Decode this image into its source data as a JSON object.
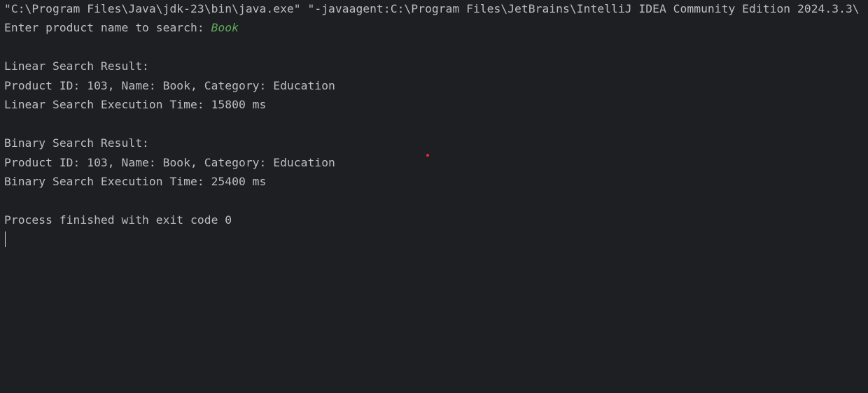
{
  "console": {
    "command_line": "\"C:\\Program Files\\Java\\jdk-23\\bin\\java.exe\" \"-javaagent:C:\\Program Files\\JetBrains\\IntelliJ IDEA Community Edition 2024.3.3\\",
    "prompt": "Enter product name to search: ",
    "user_input": "Book",
    "linear_header": "Linear Search Result:",
    "linear_result": "Product ID: 103, Name: Book, Category: Education",
    "linear_time": "Linear Search Execution Time: 15800 ms",
    "binary_header": "Binary Search Result:",
    "binary_result": "Product ID: 103, Name: Book, Category: Education",
    "binary_time": "Binary Search Execution Time: 25400 ms",
    "exit_message": "Process finished with exit code 0"
  },
  "colors": {
    "background": "#1e1f22",
    "text": "#bcbec4",
    "user_input": "#5fa85a",
    "marker": "#e0322b"
  }
}
